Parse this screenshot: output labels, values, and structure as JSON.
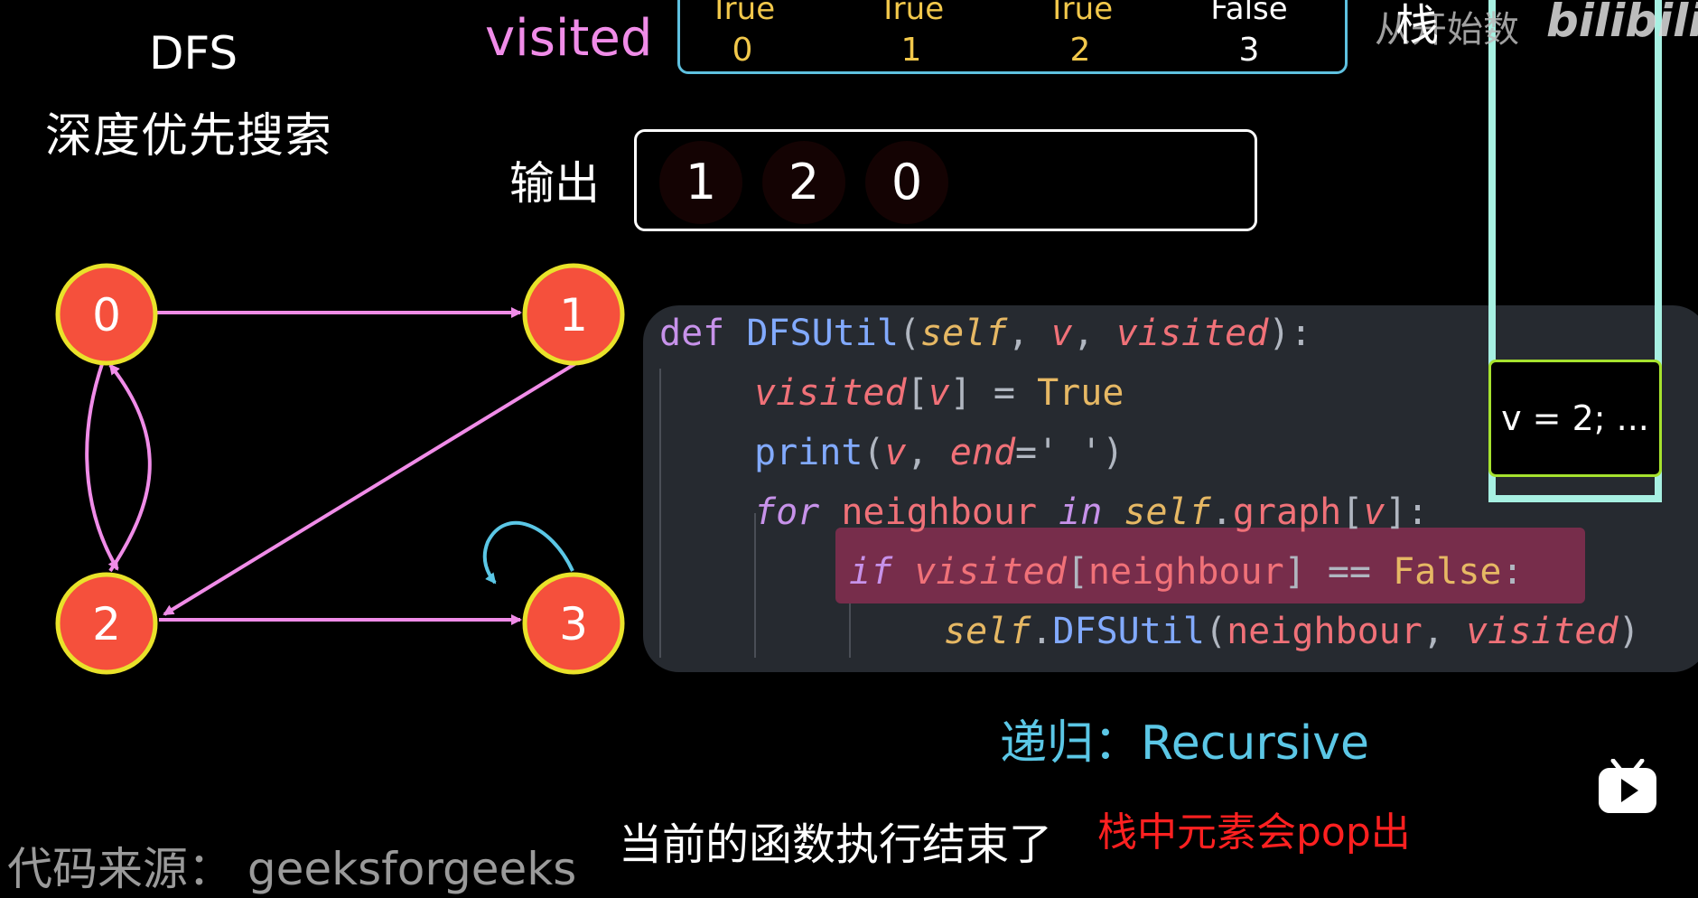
{
  "header": {
    "title": "DFS",
    "subtitle": "深度优先搜索",
    "visited_label": "visited",
    "visited": [
      {
        "value": "True",
        "index": "0"
      },
      {
        "value": "True",
        "index": "1"
      },
      {
        "value": "True",
        "index": "2"
      },
      {
        "value": "False",
        "index": "3"
      }
    ],
    "output_label": "输出",
    "output": [
      "1",
      "2",
      "0"
    ]
  },
  "graph": {
    "nodes": [
      "0",
      "1",
      "2",
      "3"
    ],
    "node_color": "#f5503c",
    "node_border": "#e9e22a",
    "edge_color": "#f08ce8",
    "selfloop_color": "#5bc7e6"
  },
  "code": {
    "highlight_color": "#772d4b",
    "lines": [
      "def DFSUtil(self, v, visited):",
      "visited[v] = True",
      "print(v, end=' ')",
      "for neighbour in self.graph[v]:",
      "if visited[neighbour] == False:",
      "self.DFSUtil(neighbour, visited)"
    ]
  },
  "stack": {
    "label": "栈",
    "item": "v = 2; ...",
    "frame_color": "#a7f0e2",
    "item_border": "#a6e22e"
  },
  "watermark": {
    "text": "从开始数",
    "logo": "bilibili"
  },
  "captions": {
    "recursive": "递归：Recursive",
    "subtitle_white": "当前的函数执行结束了",
    "subtitle_red": "栈中元素会pop出",
    "source": "代码来源： geeksforgeeks"
  },
  "icons": {
    "player": "tv-play-icon"
  }
}
